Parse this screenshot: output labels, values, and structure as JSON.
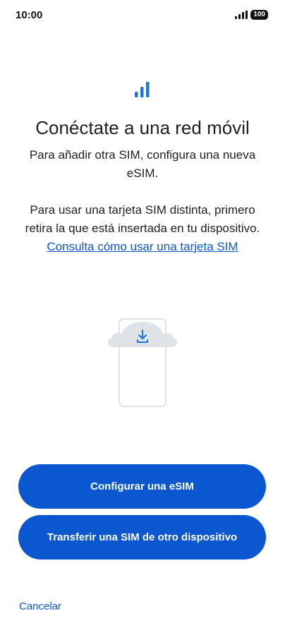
{
  "status_bar": {
    "time": "10:00",
    "battery": "100",
    "icons": [
      "signal-icon",
      "battery-icon"
    ]
  },
  "header": {
    "icon": "signal-bars-icon",
    "title": "Conéctate a una red móvil"
  },
  "body": {
    "paragraph1": "Para añadir otra SIM, configura una nueva eSIM.",
    "paragraph2_text": "Para usar una tarjeta SIM distinta, primero retira la que está insertada en tu dispositivo. ",
    "paragraph2_link": "Consulta cómo usar una tarjeta SIM"
  },
  "illustration": {
    "icon": "cloud-download-phone-icon"
  },
  "actions": {
    "primary_label": "Configurar una eSIM",
    "secondary_label": "Transferir una SIM de otro dispositivo",
    "cancel_label": "Cancelar"
  },
  "colors": {
    "accent": "#0b57d0",
    "text": "#1f1f1f",
    "background": "#ffffff"
  }
}
